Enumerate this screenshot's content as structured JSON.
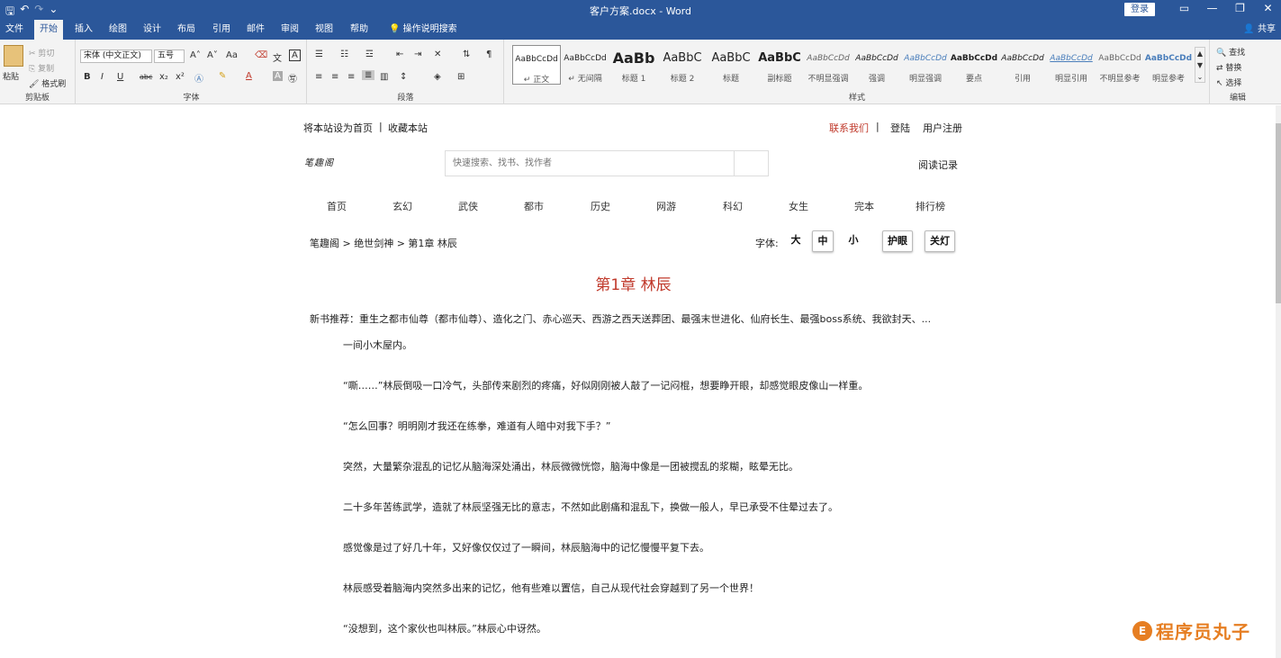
{
  "window": {
    "title": "客户方案.docx  -  Word",
    "login_label": "登录",
    "share_label": "共享"
  },
  "qat": {
    "save": "🖫",
    "undo": "↶",
    "redo": "↷",
    "more": "⌄"
  },
  "win_ctrls": {
    "ribbon_opts": "▭",
    "minimize": "—",
    "restore": "❐",
    "close": "✕"
  },
  "tabs": [
    {
      "label": "文件"
    },
    {
      "label": "开始"
    },
    {
      "label": "插入"
    },
    {
      "label": "绘图"
    },
    {
      "label": "设计"
    },
    {
      "label": "布局"
    },
    {
      "label": "引用"
    },
    {
      "label": "邮件"
    },
    {
      "label": "审阅"
    },
    {
      "label": "视图"
    },
    {
      "label": "帮助"
    },
    {
      "label": "操作说明搜索"
    }
  ],
  "ribbon": {
    "clipboard": {
      "label": "剪贴板",
      "paste": "粘贴",
      "cut": "剪切",
      "copy": "复制",
      "format_painter": "格式刷"
    },
    "font": {
      "label": "字体",
      "font_name": "宋体 (中文正文)",
      "font_size": "五号",
      "bold": "B",
      "italic": "I",
      "underline": "U",
      "strike": "abc",
      "subscript": "x₂",
      "superscript": "x²",
      "grow": "A˄",
      "shrink": "A˅",
      "case": "Aa"
    },
    "paragraph": {
      "label": "段落"
    },
    "styles": {
      "label": "样式",
      "items": [
        {
          "preview": "AaBbCcDd",
          "name": "↵ 正文"
        },
        {
          "preview": "AaBbCcDd",
          "name": "↵ 无间隔"
        },
        {
          "preview": "AaBb",
          "name": "标题 1"
        },
        {
          "preview": "AaBbC",
          "name": "标题 2"
        },
        {
          "preview": "AaBbC",
          "name": "标题"
        },
        {
          "preview": "AaBbC",
          "name": "副标题"
        },
        {
          "preview": "AaBbCcDd",
          "name": "不明显强调"
        },
        {
          "preview": "AaBbCcDd",
          "name": "强调"
        },
        {
          "preview": "AaBbCcDd",
          "name": "明显强调"
        },
        {
          "preview": "AaBbCcDd",
          "name": "要点"
        },
        {
          "preview": "AaBbCcDd",
          "name": "引用"
        },
        {
          "preview": "AaBbCcDd",
          "name": "明显引用"
        },
        {
          "preview": "AaBbCcDd",
          "name": "不明显参考"
        },
        {
          "preview": "AaBbCcDd",
          "name": "明显参考"
        }
      ]
    },
    "editing": {
      "label": "编辑",
      "find": "查找",
      "replace": "替换",
      "select": "选择"
    }
  },
  "page": {
    "top_left": "将本站设为首页",
    "top_left_sep": "|",
    "top_left2": "收藏本站",
    "contact": "联系我们",
    "contact_sep": "|",
    "login": "登陆",
    "register": "用户注册",
    "logo": "笔趣阁",
    "search_placeholder": "快速搜索、找书、找作者",
    "read_history": "阅读记录",
    "nav": [
      "首页",
      "玄幻",
      "武侠",
      "都市",
      "历史",
      "网游",
      "科幻",
      "女生",
      "完本",
      "排行榜"
    ],
    "breadcrumb": "笔趣阁 > 绝世剑神 > 第1章 林辰",
    "font_label": "字体:",
    "font_large": "大",
    "font_medium": "中",
    "font_small": "小",
    "eye_care": "护眼",
    "lights_off": "关灯",
    "chapter_title": "第1章 林辰",
    "recommend": "新书推荐：重生之都市仙尊（都市仙尊）、造化之门、赤心巡天、西游之西天送葬团、最强末世进化、仙府长生、最强boss系统、我欲封天、...",
    "paragraphs": [
      "一间小木屋内。",
      " “嘶……”林辰倒吸一口冷气，头部传来剧烈的疼痛，好似刚刚被人敲了一记闷棍，想要睁开眼，却感觉眼皮像山一样重。",
      " “怎么回事？明明刚才我还在练拳，难道有人暗中对我下手？”",
      "突然，大量繁杂混乱的记忆从脑海深处涌出，林辰微微恍惚，脑海中像是一团被搅乱的浆糊，眩晕无比。",
      "二十多年苦练武学，造就了林辰坚强无比的意志，不然如此剧痛和混乱下，换做一般人，早已承受不住晕过去了。",
      "感觉像是过了好几十年，又好像仅仅过了一瞬间，林辰脑海中的记忆慢慢平复下去。",
      "林辰感受着脑海内突然多出来的记忆，他有些难以置信，自己从现代社会穿越到了另一个世界！",
      " “没想到，这个家伙也叫林辰。”林辰心中讶然。"
    ]
  },
  "watermark": {
    "text": "程序员丸子",
    "logo": "E"
  },
  "colors": {
    "accent": "#2b579a",
    "chapter": "#c0392b",
    "contact": "#c0392b",
    "watermark": "#e67e22"
  }
}
